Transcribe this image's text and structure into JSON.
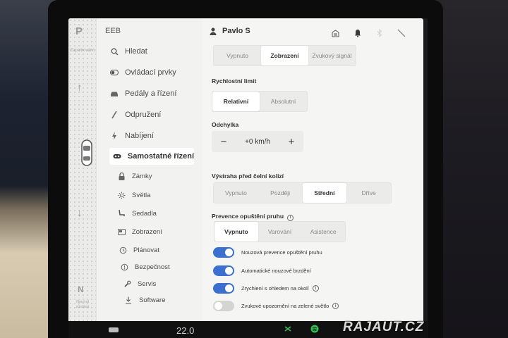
{
  "gear": {
    "park": "P",
    "park_hint": "Zaparkováno",
    "neutral": "N",
    "hold_hint": "Neutrál zůstává"
  },
  "menu": {
    "header": "EEB",
    "items": [
      {
        "label": "Hledat",
        "icon": "search-icon"
      },
      {
        "label": "Ovládací prvky",
        "icon": "toggle-icon"
      },
      {
        "label": "Pedály a řízení",
        "icon": "car-icon"
      },
      {
        "label": "Odpružení",
        "icon": "suspension-icon"
      },
      {
        "label": "Nabíjení",
        "icon": "lightning-icon"
      },
      {
        "label": "Samostatné řízení",
        "icon": "steering-icon"
      },
      {
        "label": "Zámky",
        "icon": "lock-icon"
      },
      {
        "label": "Světla",
        "icon": "sun-icon"
      },
      {
        "label": "Sedadla",
        "icon": "seat-icon"
      },
      {
        "label": "Zobrazení",
        "icon": "display-icon"
      },
      {
        "label": "Plánovat",
        "icon": "clock-icon"
      },
      {
        "label": "Bezpečnost",
        "icon": "shield-icon"
      },
      {
        "label": "Servis",
        "icon": "wrench-icon"
      },
      {
        "label": "Software",
        "icon": "download-icon"
      }
    ]
  },
  "header": {
    "user": "Pavlo S"
  },
  "top_seg": {
    "options": [
      "Vypnuto",
      "Zobrazení",
      "Zvukový signál"
    ],
    "selected": "Zobrazení"
  },
  "speed_limit": {
    "label": "Rychlostní limit",
    "options": [
      "Relativní",
      "Absolutní"
    ],
    "selected": "Relativní"
  },
  "offset": {
    "label": "Odchylka",
    "minus": "−",
    "value": "+0 km/h",
    "plus": "+"
  },
  "collision": {
    "label": "Výstraha před čelní kolizí",
    "options": [
      "Vypnuto",
      "Později",
      "Střední",
      "Dříve"
    ],
    "selected": "Střední"
  },
  "lane_departure": {
    "label": "Prevence opuštění pruhu",
    "info": "i",
    "options": [
      "Vypnuto",
      "Varování",
      "Asistence"
    ],
    "selected": "Vypnuto"
  },
  "toggles": [
    {
      "label": "Nouzová prevence opuštění pruhu",
      "on": true,
      "info": ""
    },
    {
      "label": "Automatické nouzové brzdění",
      "on": true,
      "info": ""
    },
    {
      "label": "Zrychlení s ohledem na okolí",
      "on": true,
      "info": "i"
    },
    {
      "label": "Zvukové upozornění na zelené světlo",
      "on": false,
      "info": "i"
    }
  ],
  "bottom": {
    "temperature": "22.0"
  },
  "watermark": "RAJAUT.CZ",
  "colors": {
    "toggle_on": "#3b6fd0",
    "toggle_off": "#d4d4d2",
    "screen_bg": "#f5f5f4"
  }
}
